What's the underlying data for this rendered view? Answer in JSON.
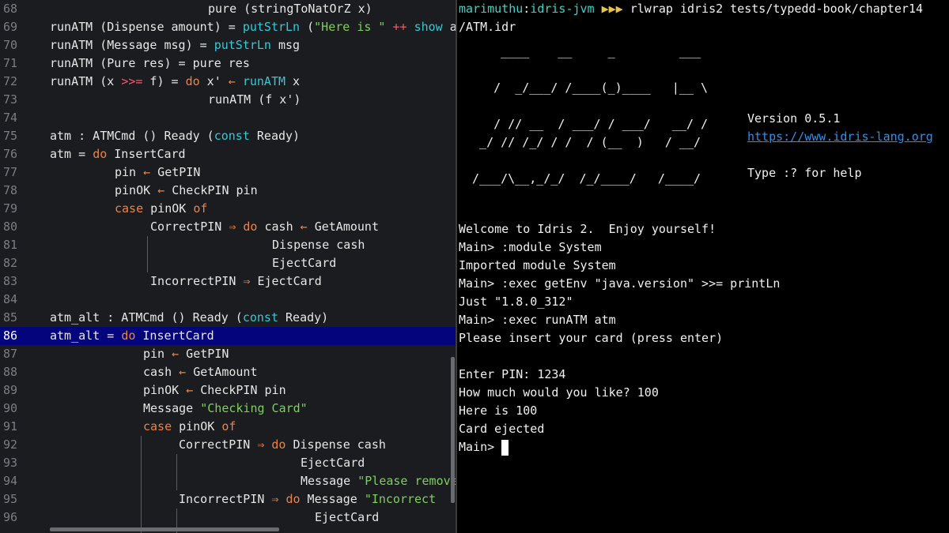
{
  "editor": {
    "lines": [
      {
        "n": "68",
        "parts": [
          [
            "pure (stringToNatOrZ x)",
            ""
          ]
        ],
        "indent": 200
      },
      {
        "n": "69",
        "parts": [
          [
            "runATM (Dispense amount) = ",
            ""
          ],
          [
            "putStrLn",
            "fn"
          ],
          [
            " (",
            ""
          ],
          [
            "\"Here is \"",
            "str"
          ],
          [
            " ",
            ""
          ],
          [
            "++",
            "op"
          ],
          [
            " ",
            ""
          ],
          [
            "show",
            "fn"
          ],
          [
            " a",
            ""
          ]
        ],
        "indent": 0
      },
      {
        "n": "70",
        "parts": [
          [
            "runATM (Message msg) = ",
            ""
          ],
          [
            "putStrLn",
            "fn"
          ],
          [
            " msg",
            ""
          ]
        ],
        "indent": 0
      },
      {
        "n": "71",
        "parts": [
          [
            "runATM (Pure res) = pure res",
            ""
          ]
        ],
        "indent": 0
      },
      {
        "n": "72",
        "parts": [
          [
            "runATM (x ",
            ""
          ],
          [
            ">>=",
            "op"
          ],
          [
            " f) = ",
            ""
          ],
          [
            "do",
            "kw"
          ],
          [
            " x' ",
            ""
          ],
          [
            "←",
            "arr"
          ],
          [
            " ",
            ""
          ],
          [
            "runATM",
            "fn"
          ],
          [
            " x",
            ""
          ]
        ],
        "indent": 0
      },
      {
        "n": "73",
        "parts": [
          [
            "runATM (f x')",
            ""
          ]
        ],
        "indent": 200
      },
      {
        "n": "74",
        "parts": [],
        "indent": 0
      },
      {
        "n": "75",
        "parts": [
          [
            "atm : ATMCmd () Ready (",
            ""
          ],
          [
            "const",
            "fn"
          ],
          [
            " Ready)",
            ""
          ]
        ],
        "indent": 0
      },
      {
        "n": "76",
        "parts": [
          [
            "atm = ",
            ""
          ],
          [
            "do",
            "kw"
          ],
          [
            " InsertCard",
            ""
          ]
        ],
        "indent": 0
      },
      {
        "n": "77",
        "parts": [
          [
            "pin ",
            ""
          ],
          [
            "←",
            "arr"
          ],
          [
            " GetPIN",
            ""
          ]
        ],
        "indent": 82
      },
      {
        "n": "78",
        "parts": [
          [
            "pinOK ",
            ""
          ],
          [
            "←",
            "arr"
          ],
          [
            " CheckPIN pin",
            ""
          ]
        ],
        "indent": 82
      },
      {
        "n": "79",
        "parts": [
          [
            "case",
            "kw"
          ],
          [
            " pinOK ",
            ""
          ],
          [
            "of",
            "kw"
          ]
        ],
        "indent": 82
      },
      {
        "n": "80",
        "parts": [
          [
            "CorrectPIN ",
            ""
          ],
          [
            "⇒",
            "arr"
          ],
          [
            " ",
            ""
          ],
          [
            "do",
            "kw"
          ],
          [
            " cash ",
            ""
          ],
          [
            "←",
            "arr"
          ],
          [
            " GetAmount",
            ""
          ]
        ],
        "indent": 127
      },
      {
        "n": "81",
        "parts": [
          [
            "Dispense cash",
            ""
          ]
        ],
        "indent": 281
      },
      {
        "n": "82",
        "parts": [
          [
            "EjectCard",
            ""
          ]
        ],
        "indent": 281
      },
      {
        "n": "83",
        "parts": [
          [
            "IncorrectPIN ",
            ""
          ],
          [
            "⇒",
            "arr"
          ],
          [
            " EjectCard",
            ""
          ]
        ],
        "indent": 127
      },
      {
        "n": "84",
        "parts": [],
        "indent": 0
      },
      {
        "n": "85",
        "parts": [
          [
            "atm_alt : ATMCmd () Ready (",
            ""
          ],
          [
            "const",
            "fn"
          ],
          [
            " Ready)",
            ""
          ]
        ],
        "indent": 0
      },
      {
        "n": "86",
        "parts": [
          [
            "atm_alt = ",
            ""
          ],
          [
            "do",
            "kw"
          ],
          [
            " InsertCard",
            ""
          ]
        ],
        "indent": 0,
        "current": true
      },
      {
        "n": "87",
        "parts": [
          [
            "pin ",
            ""
          ],
          [
            "←",
            "arr"
          ],
          [
            " GetPIN",
            ""
          ]
        ],
        "indent": 118
      },
      {
        "n": "88",
        "parts": [
          [
            "cash ",
            ""
          ],
          [
            "←",
            "arr"
          ],
          [
            " GetAmount",
            ""
          ]
        ],
        "indent": 118
      },
      {
        "n": "89",
        "parts": [
          [
            "pinOK ",
            ""
          ],
          [
            "←",
            "arr"
          ],
          [
            " CheckPIN pin",
            ""
          ]
        ],
        "indent": 118
      },
      {
        "n": "90",
        "parts": [
          [
            "Message ",
            ""
          ],
          [
            "\"Checking Card\"",
            "str"
          ]
        ],
        "indent": 118
      },
      {
        "n": "91",
        "parts": [
          [
            "case",
            "kw"
          ],
          [
            " pinOK ",
            ""
          ],
          [
            "of",
            "kw"
          ]
        ],
        "indent": 118
      },
      {
        "n": "92",
        "parts": [
          [
            "CorrectPIN ",
            ""
          ],
          [
            "⇒",
            "arr"
          ],
          [
            " ",
            ""
          ],
          [
            "do",
            "kw"
          ],
          [
            " Dispense cash",
            ""
          ]
        ],
        "indent": 163
      },
      {
        "n": "93",
        "parts": [
          [
            "EjectCard",
            ""
          ]
        ],
        "indent": 317
      },
      {
        "n": "94",
        "parts": [
          [
            "Message ",
            ""
          ],
          [
            "\"Please remove",
            "str"
          ]
        ],
        "indent": 317
      },
      {
        "n": "95",
        "parts": [
          [
            "IncorrectPIN ",
            ""
          ],
          [
            "⇒",
            "arr"
          ],
          [
            " ",
            ""
          ],
          [
            "do",
            "kw"
          ],
          [
            " Message ",
            ""
          ],
          [
            "\"Incorrect",
            "str"
          ]
        ],
        "indent": 163
      },
      {
        "n": "96",
        "parts": [
          [
            "EjectCard",
            ""
          ]
        ],
        "indent": 335
      }
    ]
  },
  "terminal": {
    "user": "marimuthu",
    "host": "idris-jvm",
    "prompt_arrows": "▶▶▶",
    "command": "rlwrap idris2 tests/typedd-book/chapter14",
    "command_cont": "/ATM.idr",
    "banner": [
      "     ____    __     _         ___",
      "",
      "    /  _/___/ /____(_)____   |__ \\",
      "",
      "    / // __  / ___/ / ___/   __/ /",
      "  _/ // /_/ / /  / (__  )   / __/",
      "",
      " /___/\\__,_/_/  /_/____/   /____/"
    ],
    "version": "Version 0.5.1",
    "link": "https://www.idris-lang.org",
    "help": "Type :? for help",
    "output": [
      "Welcome to Idris 2.  Enjoy yourself!",
      "Main> :module System",
      "Imported module System",
      "Main> :exec getEnv \"java.version\" >>= printLn",
      "Just \"1.8.0_312\"",
      "Main> :exec runATM atm",
      "Please insert your card (press enter)",
      "",
      "Enter PIN: 1234",
      "How much would you like? 100",
      "Here is 100",
      "Card ejected"
    ],
    "final_prompt": "Main> "
  }
}
